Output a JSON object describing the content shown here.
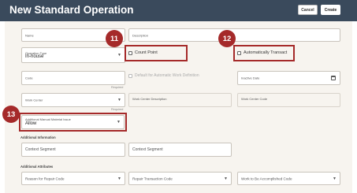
{
  "header": {
    "title": "New Standard Operation",
    "cancel_label": "Cancel",
    "create_label": "Create"
  },
  "fields": {
    "name": {
      "label": "Name"
    },
    "description": {
      "label": "Description"
    },
    "operation_type": {
      "label": "Operation Type",
      "value": "In-house"
    },
    "count_point": {
      "label": "Count Point"
    },
    "automatically_transact": {
      "label": "Automatically Transact"
    },
    "code": {
      "label": "Code",
      "required": "Required"
    },
    "default_automatic_work_definition": {
      "label": "Default for Automatic Work Definition"
    },
    "inactive_date": {
      "label": "Inactive Date"
    },
    "work_center": {
      "label": "Work Center",
      "required": "Required"
    },
    "work_center_description": {
      "label": "Work Center Description"
    },
    "work_center_code": {
      "label": "Work Center Code"
    },
    "additional_manual_material_issue": {
      "label": "Additional Manual Material Issue",
      "value": "Allow"
    }
  },
  "additional_information": {
    "title": "Additional Information",
    "context_segment_1": "Context Segment",
    "context_segment_2": "Context Segment"
  },
  "additional_attributes": {
    "title": "Additional Attributes",
    "reason_for_repair_code": "Reason for Repair Code",
    "repair_transaction_code": "Repair Transaction Code",
    "work_to_be_accomplished_code": "Work to Be Accomplished Code"
  },
  "callouts": {
    "c11": "11",
    "c12": "12",
    "c13": "13"
  },
  "colors": {
    "header": "#3a4a5c",
    "highlight": "#a52a2a"
  }
}
